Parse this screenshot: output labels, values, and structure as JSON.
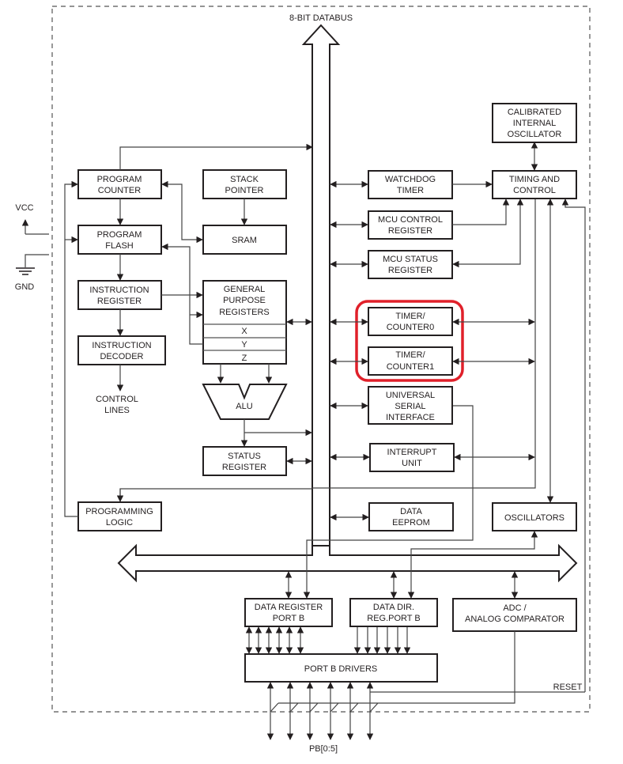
{
  "diagram": {
    "databus_label": "8-BIT DATABUS",
    "vcc_label": "VCC",
    "gnd_label": "GND",
    "control_lines": [
      "CONTROL",
      "LINES"
    ],
    "reset_label": "RESET",
    "pins_label": "PB[0:5]",
    "highlight_color": "#e0202a",
    "blocks": {
      "program_counter": [
        "PROGRAM",
        "COUNTER"
      ],
      "stack_pointer": [
        "STACK",
        "POINTER"
      ],
      "program_flash": [
        "PROGRAM",
        "FLASH"
      ],
      "sram": [
        "SRAM"
      ],
      "instruction_register": [
        "INSTRUCTION",
        "REGISTER"
      ],
      "gpr": [
        "GENERAL",
        "PURPOSE",
        "REGISTERS"
      ],
      "gpr_x": "X",
      "gpr_y": "Y",
      "gpr_z": "Z",
      "instruction_decoder": [
        "INSTRUCTION",
        "DECODER"
      ],
      "alu": "ALU",
      "status_register": [
        "STATUS",
        "REGISTER"
      ],
      "programming_logic": [
        "PROGRAMMING",
        "LOGIC"
      ],
      "calibrated_osc": [
        "CALIBRATED",
        "INTERNAL",
        "OSCILLATOR"
      ],
      "watchdog": [
        "WATCHDOG",
        "TIMER"
      ],
      "timing_control": [
        "TIMING AND",
        "CONTROL"
      ],
      "mcu_control": [
        "MCU CONTROL",
        "REGISTER"
      ],
      "mcu_status": [
        "MCU STATUS",
        "REGISTER"
      ],
      "timer0": [
        "TIMER/",
        "COUNTER0"
      ],
      "timer1": [
        "TIMER/",
        "COUNTER1"
      ],
      "usi": [
        "UNIVERSAL",
        "SERIAL",
        "INTERFACE"
      ],
      "interrupt": [
        "INTERRUPT",
        "UNIT"
      ],
      "eeprom": [
        "DATA",
        "EEPROM"
      ],
      "oscillators": [
        "OSCILLATORS"
      ],
      "data_register": [
        "DATA REGISTER",
        "PORT B"
      ],
      "data_dir": [
        "DATA DIR.",
        "REG.PORT B"
      ],
      "adc": [
        "ADC /",
        "ANALOG COMPARATOR"
      ],
      "port_drivers": [
        "PORT B DRIVERS"
      ]
    }
  }
}
